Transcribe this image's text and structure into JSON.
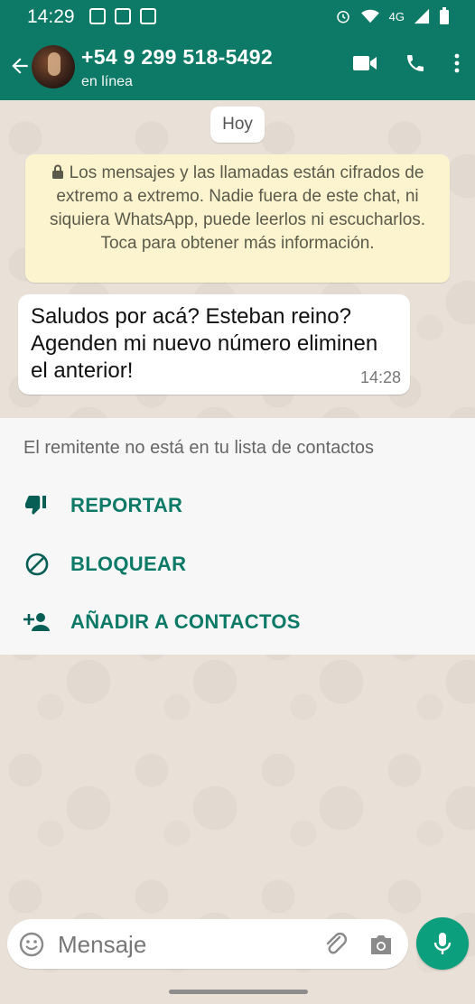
{
  "status_bar": {
    "time": "14:29",
    "network": "4G"
  },
  "header": {
    "contact_name": "+54 9 299 518-5492",
    "presence": "en línea"
  },
  "chat": {
    "date_chip": "Hoy",
    "encryption_notice": "Los mensajes y las llamadas están cifrados de extremo a extremo. Nadie fuera de este chat, ni siquiera WhatsApp, puede leerlos ni escucharlos. Toca para obtener más información.",
    "messages": [
      {
        "text": "Saludos por acá? Esteban reino? Agenden mi nuevo número eliminen el anterior!",
        "time": "14:28"
      }
    ]
  },
  "unknown_sender": {
    "note": "El remitente no está en tu lista de contactos",
    "actions": [
      {
        "label": "REPORTAR",
        "icon": "thumbs-down-icon"
      },
      {
        "label": "BLOQUEAR",
        "icon": "block-icon"
      },
      {
        "label": "AÑADIR A CONTACTOS",
        "icon": "add-contact-icon"
      }
    ]
  },
  "composer": {
    "placeholder": "Mensaje"
  },
  "colors": {
    "header": "#0c7a66",
    "accent": "#0c9f7e",
    "system_note": "#fcf3cf"
  }
}
